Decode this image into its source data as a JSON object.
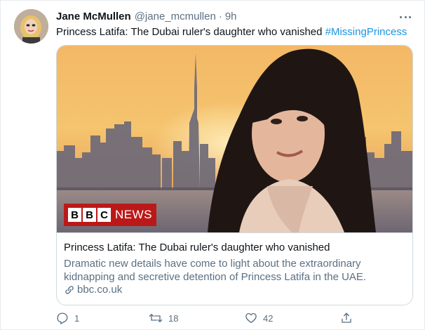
{
  "author": {
    "display_name": "Jane McMullen",
    "handle": "@jane_mcmullen",
    "separator": "·",
    "time": "9h"
  },
  "tweet": {
    "text": "Princess Latifa: The Dubai ruler's daughter who vanished ",
    "hashtag": "#MissingPrincess"
  },
  "card": {
    "logo_letters": [
      "B",
      "B",
      "C"
    ],
    "logo_word": "NEWS",
    "title": "Princess Latifa: The Dubai ruler's daughter who vanished",
    "description": "Dramatic new details have come to light about the extraordinary kidnapping and secretive detention of Princess Latifa in the UAE.",
    "domain": "bbc.co.uk"
  },
  "actions": {
    "reply_count": "1",
    "retweet_count": "18",
    "like_count": "42",
    "share_count": ""
  },
  "icons": [
    "more-icon",
    "link-icon",
    "reply-icon",
    "retweet-icon",
    "like-icon",
    "share-icon"
  ],
  "colors": {
    "link": "#1b95e0",
    "secondary_text": "#5b7083",
    "border": "#cfd9de",
    "bbc_red": "#bb1919"
  }
}
